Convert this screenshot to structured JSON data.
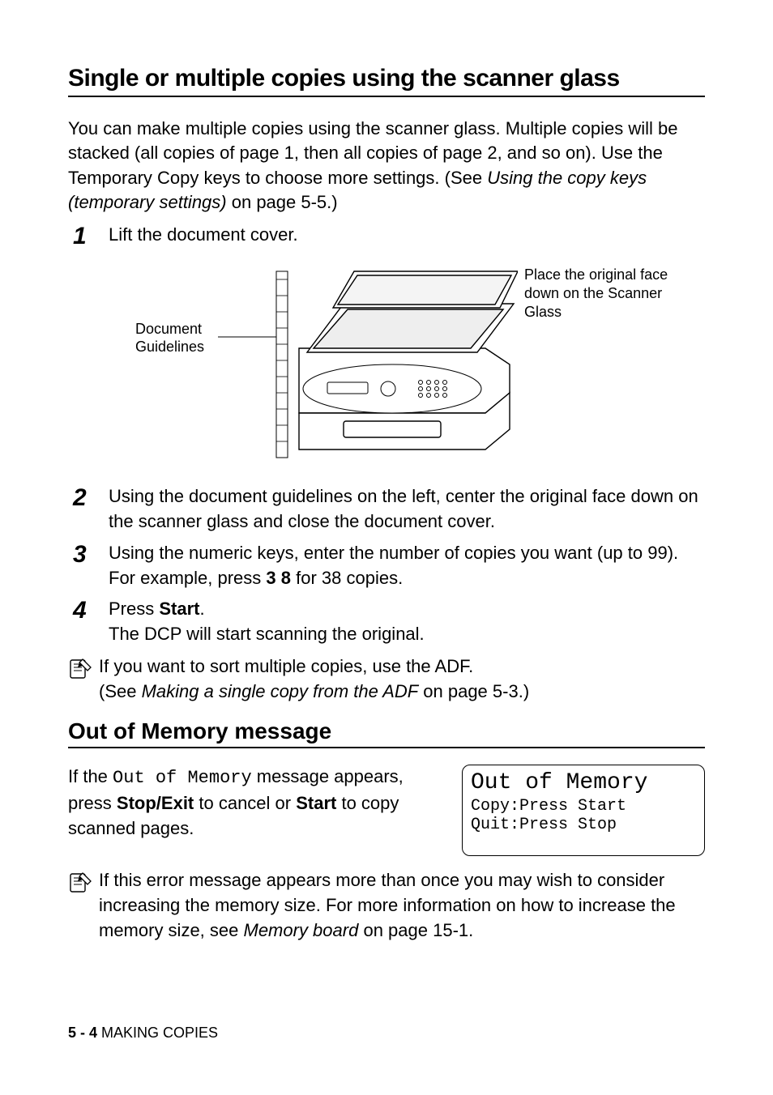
{
  "section1": {
    "heading": "Single or multiple copies using the scanner glass",
    "intro_a": "You can make multiple copies using the scanner glass. Multiple copies will be stacked (all copies of page 1, then all copies of page 2, and so on). Use the Temporary Copy keys to choose more settings. (See ",
    "intro_ref": "Using the copy keys (temporary settings)",
    "intro_b": " on page 5-5.)",
    "steps": {
      "s1": "Lift the document cover.",
      "s2": "Using the document guidelines on the left, center the original face down on the scanner glass and close the document cover.",
      "s3a": "Using the numeric keys, enter the number of copies you want (up to 99).",
      "s3b_a": "For example, press ",
      "s3b_num": "3 8",
      "s3b_b": " for 38 copies.",
      "s4a_a": "Press ",
      "s4a_b": "Start",
      "s4a_c": ".",
      "s4b": "The DCP will start scanning the original."
    },
    "fig_left": "Document Guidelines",
    "fig_right": "Place the original face down on the Scanner Glass",
    "note_a": "If you want to sort multiple copies, use the ADF.",
    "note_b_a": "(See ",
    "note_b_ref": "Making a single copy from the ADF",
    "note_b_b": " on page 5-3.)"
  },
  "section2": {
    "heading": "Out of Memory message",
    "para_a": "If the ",
    "para_mono": "Out of Memory",
    "para_b": " message appears, press ",
    "para_bold1": "Stop/Exit",
    "para_c": " to cancel or ",
    "para_bold2": "Start",
    "para_d": " to copy scanned pages.",
    "lcd": {
      "title": "Out of Memory",
      "l1": "Copy:Press Start",
      "l2": "Quit:Press Stop"
    },
    "note_a": "If this error message appears more than once you may wish to consider increasing the memory size. For more information on how to increase the memory size, see ",
    "note_ref": "Memory board",
    "note_b": " on page 15-1."
  },
  "footer": {
    "pg": "5 - 4",
    "chap": "   MAKING COPIES"
  }
}
